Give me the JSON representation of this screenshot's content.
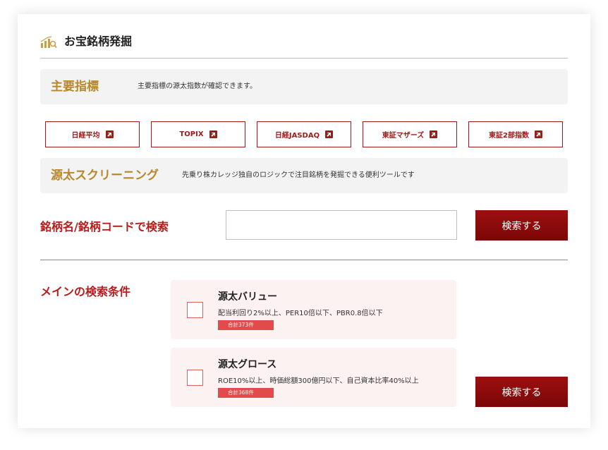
{
  "header": {
    "title": "お宝銘柄発掘",
    "icon": "chart-search-icon"
  },
  "indices_section": {
    "title": "主要指標",
    "description": "主要指標の源太指数が確認できます。",
    "buttons": [
      {
        "label": "日経平均",
        "icon": "external-link-icon"
      },
      {
        "label": "TOPIX",
        "icon": "external-link-icon"
      },
      {
        "label": "日経JASDAQ",
        "icon": "external-link-icon"
      },
      {
        "label": "東証マザーズ",
        "icon": "external-link-icon"
      },
      {
        "label": "東証2部指数",
        "icon": "external-link-icon"
      }
    ]
  },
  "screening_section": {
    "title": "源太スクリーニング",
    "description": "先乗り株カレッジ独自のロジックで注目銘柄を発掘できる便利ツールです"
  },
  "search": {
    "label": "銘柄名/銘柄コードで検索",
    "value": "",
    "button_label": "検索する"
  },
  "main_conditions": {
    "label": "メインの検索条件",
    "items": [
      {
        "name": "源太バリュー",
        "description": "配当利回り2%以上、PER10倍以下、PBR0.8倍以下",
        "badge": "合計373件",
        "checked": false
      },
      {
        "name": "源太グロース",
        "description": "ROE10%以上、時価総額300億円以下、自己資本比率40%以上",
        "badge": "合計368件",
        "checked": false
      }
    ],
    "button_label": "検索する"
  },
  "colors": {
    "accent_red": "#a11a1a",
    "gold": "#b8862b",
    "badge_red": "#e24b4b",
    "band_gray": "#f3f3f3",
    "condition_bg": "#fdf2f2"
  }
}
